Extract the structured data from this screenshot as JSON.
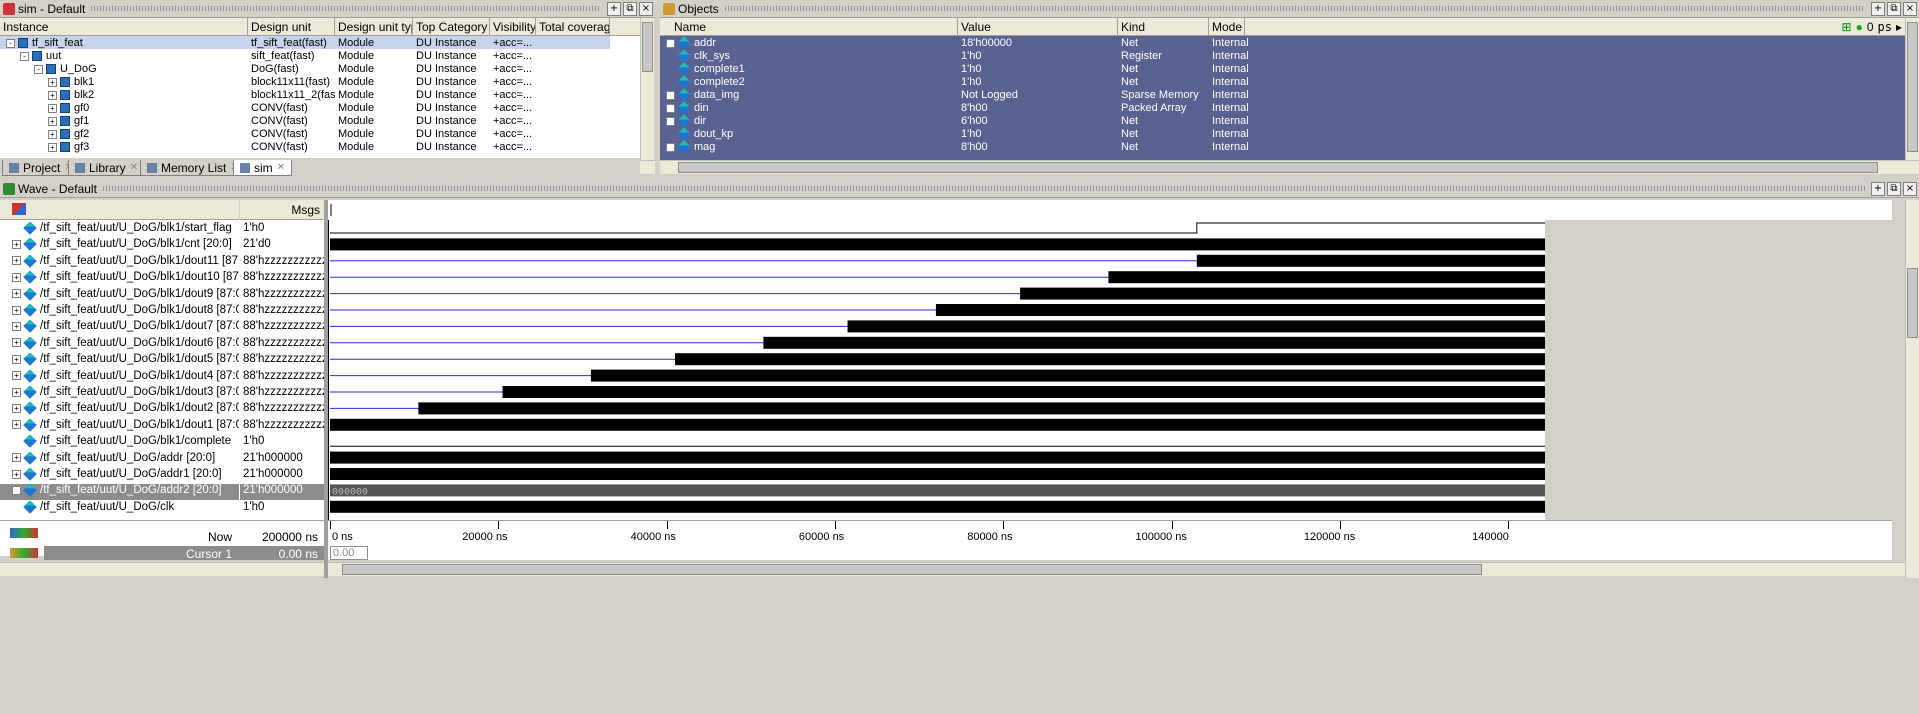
{
  "sim_panel": {
    "title": "sim - Default",
    "columns": [
      "Instance",
      "Design unit",
      "Design unit type",
      "Top Category",
      "Visibility",
      "Total coverage"
    ],
    "rows": [
      {
        "instance": "tf_sift_feat",
        "unit": "tf_sift_feat(fast)",
        "type": "Module",
        "cat": "DU Instance",
        "vis": "+acc=...",
        "indent": 0,
        "exp": "-"
      },
      {
        "instance": "uut",
        "unit": "sift_feat(fast)",
        "type": "Module",
        "cat": "DU Instance",
        "vis": "+acc=...",
        "indent": 1,
        "exp": "-"
      },
      {
        "instance": "U_DoG",
        "unit": "DoG(fast)",
        "type": "Module",
        "cat": "DU Instance",
        "vis": "+acc=...",
        "indent": 2,
        "exp": "-"
      },
      {
        "instance": "blk1",
        "unit": "block11x11(fast)",
        "type": "Module",
        "cat": "DU Instance",
        "vis": "+acc=...",
        "indent": 3,
        "exp": "+"
      },
      {
        "instance": "blk2",
        "unit": "block11x11_2(fast)",
        "type": "Module",
        "cat": "DU Instance",
        "vis": "+acc=...",
        "indent": 3,
        "exp": "+"
      },
      {
        "instance": "gf0",
        "unit": "CONV(fast)",
        "type": "Module",
        "cat": "DU Instance",
        "vis": "+acc=...",
        "indent": 3,
        "exp": "+"
      },
      {
        "instance": "gf1",
        "unit": "CONV(fast)",
        "type": "Module",
        "cat": "DU Instance",
        "vis": "+acc=...",
        "indent": 3,
        "exp": "+"
      },
      {
        "instance": "gf2",
        "unit": "CONV(fast)",
        "type": "Module",
        "cat": "DU Instance",
        "vis": "+acc=...",
        "indent": 3,
        "exp": "+"
      },
      {
        "instance": "gf3",
        "unit": "CONV(fast)",
        "type": "Module",
        "cat": "DU Instance",
        "vis": "+acc=...",
        "indent": 3,
        "exp": "+"
      }
    ],
    "tabs": [
      "Project",
      "Library",
      "Memory List",
      "sim"
    ]
  },
  "objects_panel": {
    "title": "Objects",
    "columns": [
      "Name",
      "Value",
      "Kind",
      "Mode"
    ],
    "time_label": "0",
    "time_unit": "ps",
    "rows": [
      {
        "name": "addr",
        "value": "18'h00000",
        "kind": "Net",
        "mode": "Internal",
        "exp": true
      },
      {
        "name": "clk_sys",
        "value": "1'h0",
        "kind": "Register",
        "mode": "Internal",
        "exp": false
      },
      {
        "name": "complete1",
        "value": "1'h0",
        "kind": "Net",
        "mode": "Internal",
        "exp": false
      },
      {
        "name": "complete2",
        "value": "1'h0",
        "kind": "Net",
        "mode": "Internal",
        "exp": false
      },
      {
        "name": "data_img",
        "value": "Not Logged",
        "kind": "Sparse Memory",
        "mode": "Internal",
        "exp": true
      },
      {
        "name": "din",
        "value": "8'h00",
        "kind": "Packed Array",
        "mode": "Internal",
        "exp": true
      },
      {
        "name": "dir",
        "value": "6'h00",
        "kind": "Net",
        "mode": "Internal",
        "exp": true
      },
      {
        "name": "dout_kp",
        "value": "1'h0",
        "kind": "Net",
        "mode": "Internal",
        "exp": false
      },
      {
        "name": "mag",
        "value": "8'h00",
        "kind": "Net",
        "mode": "Internal",
        "exp": true
      }
    ]
  },
  "wave_panel": {
    "title": "Wave - Default",
    "msgs_label": "Msgs",
    "signals": [
      {
        "name": "/tf_sift_feat/uut/U_DoG/blk1/start_flag",
        "value": "1'h0",
        "exp": false
      },
      {
        "name": "/tf_sift_feat/uut/U_DoG/blk1/cnt [20:0]",
        "value": "21'd0",
        "exp": true
      },
      {
        "name": "/tf_sift_feat/uut/U_DoG/blk1/dout11 [87...",
        "value": "88'hzzzzzzzzzzz...",
        "exp": true
      },
      {
        "name": "/tf_sift_feat/uut/U_DoG/blk1/dout10 [87...",
        "value": "88'hzzzzzzzzzzz...",
        "exp": true
      },
      {
        "name": "/tf_sift_feat/uut/U_DoG/blk1/dout9 [87:0]",
        "value": "88'hzzzzzzzzzzz...",
        "exp": true
      },
      {
        "name": "/tf_sift_feat/uut/U_DoG/blk1/dout8 [87:0]",
        "value": "88'hzzzzzzzzzzz...",
        "exp": true
      },
      {
        "name": "/tf_sift_feat/uut/U_DoG/blk1/dout7 [87:0]",
        "value": "88'hzzzzzzzzzzz...",
        "exp": true
      },
      {
        "name": "/tf_sift_feat/uut/U_DoG/blk1/dout6 [87:0]",
        "value": "88'hzzzzzzzzzzz...",
        "exp": true
      },
      {
        "name": "/tf_sift_feat/uut/U_DoG/blk1/dout5 [87:0]",
        "value": "88'hzzzzzzzzzzz...",
        "exp": true
      },
      {
        "name": "/tf_sift_feat/uut/U_DoG/blk1/dout4 [87:0]",
        "value": "88'hzzzzzzzzzzz...",
        "exp": true
      },
      {
        "name": "/tf_sift_feat/uut/U_DoG/blk1/dout3 [87:0]",
        "value": "88'hzzzzzzzzzzz...",
        "exp": true
      },
      {
        "name": "/tf_sift_feat/uut/U_DoG/blk1/dout2 [87:0]",
        "value": "88'hzzzzzzzzzzz...",
        "exp": true
      },
      {
        "name": "/tf_sift_feat/uut/U_DoG/blk1/dout1 [87:0]",
        "value": "88'hzzzzzzzzzzz...",
        "exp": true
      },
      {
        "name": "/tf_sift_feat/uut/U_DoG/blk1/complete",
        "value": "1'h0",
        "exp": false
      },
      {
        "name": "/tf_sift_feat/uut/U_DoG/addr [20:0]",
        "value": "21'h000000",
        "exp": true
      },
      {
        "name": "/tf_sift_feat/uut/U_DoG/addr1 [20:0]",
        "value": "21'h000000",
        "exp": true
      },
      {
        "name": "/tf_sift_feat/uut/U_DoG/addr2 [20:0]",
        "value": "21'h000000",
        "exp": true
      },
      {
        "name": "/tf_sift_feat/uut/U_DoG/clk",
        "value": "1'h0",
        "exp": false
      }
    ],
    "selected_wave_text": "000000",
    "now_label": "Now",
    "now_value": "200000 ns",
    "cursor_label": "Cursor 1",
    "cursor_value": "0.00 ns",
    "cursor_box": "0.00 ns",
    "ticks": [
      "0 ns",
      "20000 ns",
      "40000 ns",
      "60000 ns",
      "80000 ns",
      "100000 ns",
      "120000 ns",
      "140000"
    ]
  },
  "colors": {
    "selection": "#5a6291",
    "trace": "#000000",
    "zline": "#2a2ad8"
  }
}
